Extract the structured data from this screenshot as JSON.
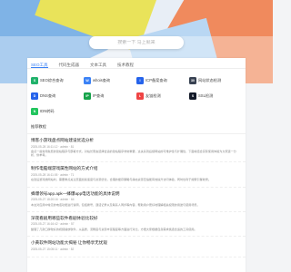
{
  "search": {
    "placeholder": "搜索一下 马上就来"
  },
  "tabs": [
    {
      "label": "SEO工具"
    },
    {
      "label": "代码生成器"
    },
    {
      "label": "文本工具"
    },
    {
      "label": "技术教程"
    }
  ],
  "tools": [
    {
      "label": "SEO综合查询",
      "icon": "seo-icon",
      "color": "#20b26b",
      "glyph": "S"
    },
    {
      "label": "whois查询",
      "icon": "whois-icon",
      "color": "#3b82f6",
      "glyph": "W"
    },
    {
      "label": "ICP备案查询",
      "icon": "icp-icon",
      "color": "#2563eb",
      "glyph": "I"
    },
    {
      "label": "网站状态检测",
      "icon": "status-icon",
      "color": "#374151",
      "glyph": "30"
    },
    {
      "label": "DNS查询",
      "icon": "dns-icon",
      "color": "#2563eb",
      "glyph": "D"
    },
    {
      "label": "IP查询",
      "icon": "ip-icon",
      "color": "#16a34a",
      "glyph": "IP"
    },
    {
      "label": "友链检测",
      "icon": "link-icon",
      "color": "#ef4444",
      "glyph": "L"
    },
    {
      "label": "SSL检测",
      "icon": "ssl-icon",
      "color": "#111827",
      "glyph": "S"
    },
    {
      "label": "IDN转码",
      "icon": "idn-icon",
      "color": "#22c55e",
      "glyph": "N"
    }
  ],
  "section": {
    "title": "推荐教程"
  },
  "articles": [
    {
      "title": "博客小游戏盘点网站建设优选分析",
      "meta": "2025-05-28 16:11:12 · admin · 81",
      "body": "盘点一些常用免费的建站程序与部署方式，对站长而言选择合适的建站程序非常重要，这关系到后续网站的可维护性与扩展性，下面将结合实际使用体验为大家逐一分析，供参考。"
    },
    {
      "title": "制作电脑端游戏属性网站的方式介绍",
      "meta": "2025-05-28 16:11:05 · admin · 71",
      "body": "在建设游戏类网站时，需要重点关注页面加载速度与资源优化，合理的缓存策略与静态资源压缩能有效提升访问体验，同时也利于搜索引擎收录。"
    },
    {
      "title": "蜂爆领号app.apk—蜂爆app电话功能的具体说明",
      "meta": "2025-05-27 18:20:16 · admin · 64",
      "body": "本文对应用中常见的电话功能进行说明，包括拨号、通话记录以及联系人同步等内容，帮助用户更好地理解相关权限的用途与使用场景。"
    },
    {
      "title": "深夜看剧用哪些软件看剧体验比较好",
      "meta": "2025-05-27 16:16:42 · admin · 57",
      "body": "整理了几款口碑较好的视频播放软件，从画质、流畅度与资源丰富程度等方面进行对比，方便大家根据自身需求挑选合适的工具使用。"
    },
    {
      "title": "小黄软件网站功能大揭秘 让你畅享无忧观",
      "meta": "2025-05-27 15:05:11 · admin · 52",
      "body": ""
    }
  ]
}
